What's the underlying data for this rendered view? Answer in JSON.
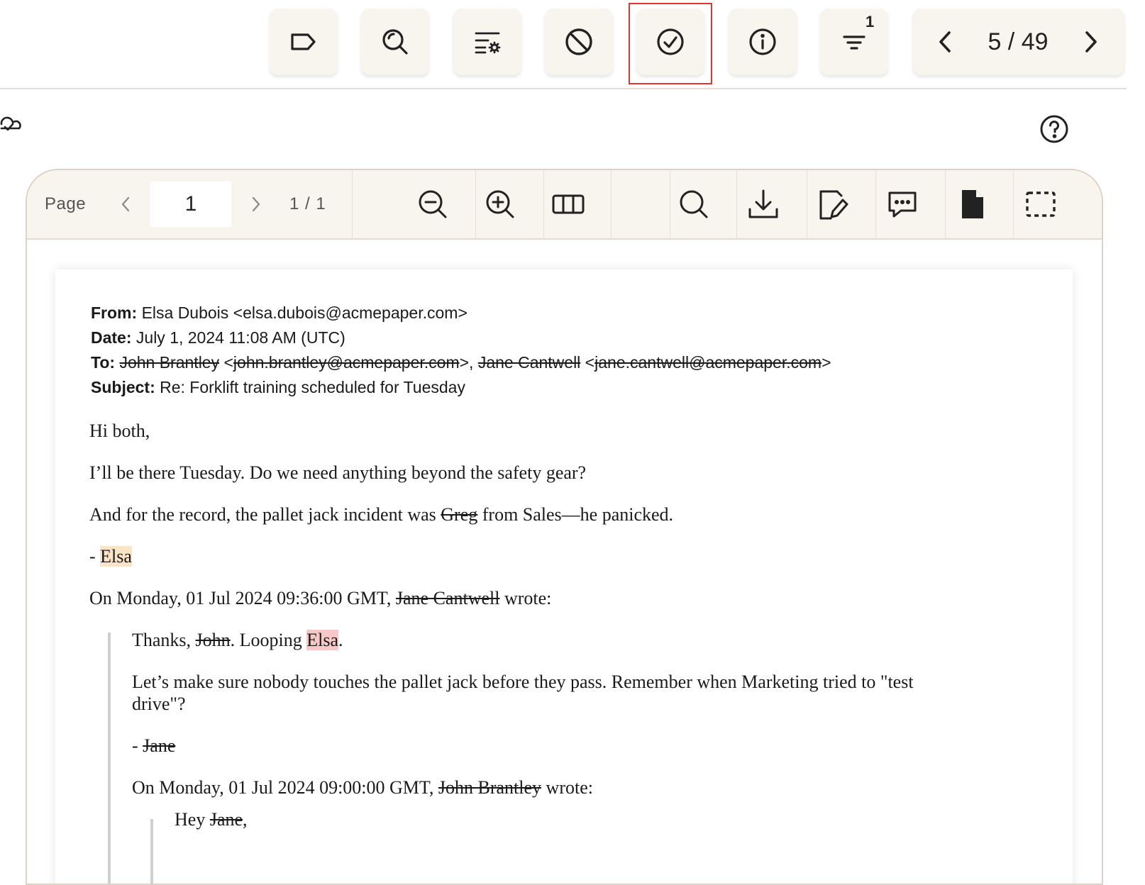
{
  "toolbar": {
    "buttons": [
      {
        "name": "tag",
        "icon": "tag-icon"
      },
      {
        "name": "search-document",
        "icon": "search-document-icon"
      },
      {
        "name": "filter-settings",
        "icon": "list-settings-icon"
      },
      {
        "name": "mark-not-relevant",
        "icon": "block-icon"
      },
      {
        "name": "mark-reviewed",
        "icon": "check-circle-icon"
      },
      {
        "name": "info",
        "icon": "info-icon"
      },
      {
        "name": "filter",
        "icon": "filter-icon"
      }
    ],
    "filter_badge": "1",
    "pager_text": "5 / 49"
  },
  "viewer": {
    "page_label": "Page",
    "page_value": "1",
    "page_count": "1 / 1"
  },
  "email": {
    "from_label": "From:",
    "from_value": "Elsa Dubois <elsa.dubois@acmepaper.com>",
    "date_label": "Date:",
    "date_value": "July 1, 2024 11:08 AM (UTC)",
    "to_label": "To:",
    "to_name1": "John Brantley",
    "to_lt1": " <",
    "to_email1": "john.brantley@acmepaper.com",
    "to_sep": ">, ",
    "to_name2": "Jane Cantwell",
    "to_lt2": " <",
    "to_email2": "jane.cantwell@acmepaper.com",
    "to_gt2": ">",
    "subject_label": "Subject:",
    "subject_value": "Re: Forklift training scheduled for Tuesday",
    "greeting": "Hi both,",
    "line1": "I’ll be there Tuesday. Do we need anything beyond the safety gear?",
    "line2_a": "And for the record, the pallet jack incident was ",
    "line2_redacted": "Greg",
    "line2_b": " from Sales—he panicked.",
    "signoff_dash": "- ",
    "signoff_name": "Elsa",
    "quote1_a": "On Monday, 01 Jul 2024 09:36:00 GMT, ",
    "quote1_redacted": "Jane Cantwell",
    "quote1_b": " wrote:",
    "q_thanks_a": "Thanks, ",
    "q_thanks_redacted": "John",
    "q_thanks_b": ". Looping ",
    "q_thanks_name": "Elsa",
    "q_thanks_c": ".",
    "q_line1": "Let’s make sure nobody touches the pallet jack before they pass. Remember when Marketing tried to \"test",
    "q_line1_cont": "drive\"?",
    "q_sign_dash": "- ",
    "q_sign_redacted": "Jane",
    "quote2_a": "On Monday, 01 Jul 2024 09:00:00 GMT, ",
    "quote2_redacted": "John Brantley",
    "quote2_b": " wrote:",
    "qq_hey": "Hey ",
    "qq_hey_redacted": "Jane",
    "qq_hey_end": ","
  }
}
